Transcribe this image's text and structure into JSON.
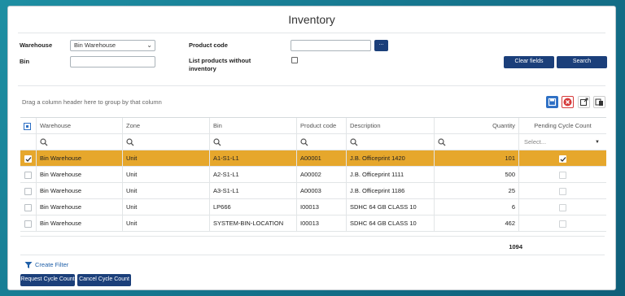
{
  "page": {
    "title": "Inventory"
  },
  "filters": {
    "warehouse_label": "Warehouse",
    "warehouse_value": "Bin Warehouse",
    "bin_label": "Bin",
    "bin_value": "",
    "product_code_label": "Product code",
    "product_code_value": "",
    "lookup_label": "...",
    "list_without_inventory_label_1": "List products without",
    "list_without_inventory_label_2": "inventory",
    "list_without_inventory_checked": false,
    "clear_label": "Clear fields",
    "search_label": "Search"
  },
  "grid": {
    "group_hint": "Drag a column header here to group by that column",
    "columns": [
      "Warehouse",
      "Zone",
      "Bin",
      "Product code",
      "Description",
      "Quantity",
      "Pending Cycle Count"
    ],
    "pending_filter_placeholder": "Select...",
    "rows": [
      {
        "warehouse": "Bin Warehouse",
        "zone": "Unit",
        "bin": "A1-S1-L1",
        "product_code": "A00001",
        "description": "J.B. Officeprint 1420",
        "quantity": "101",
        "pending": true,
        "selected": true
      },
      {
        "warehouse": "Bin Warehouse",
        "zone": "Unit",
        "bin": "A2-S1-L1",
        "product_code": "A00002",
        "description": "J.B. Officeprint 1111",
        "quantity": "500",
        "pending": false,
        "selected": false
      },
      {
        "warehouse": "Bin Warehouse",
        "zone": "Unit",
        "bin": "A3-S1-L1",
        "product_code": "A00003",
        "description": "J.B. Officeprint 1186",
        "quantity": "25",
        "pending": false,
        "selected": false
      },
      {
        "warehouse": "Bin Warehouse",
        "zone": "Unit",
        "bin": "LP666",
        "product_code": "I00013",
        "description": "SDHC 64 GB CLASS 10",
        "quantity": "6",
        "pending": false,
        "selected": false
      },
      {
        "warehouse": "Bin Warehouse",
        "zone": "Unit",
        "bin": "SYSTEM-BIN-LOCATION",
        "product_code": "I00013",
        "description": "SDHC 64 GB CLASS 10",
        "quantity": "462",
        "pending": false,
        "selected": false
      }
    ],
    "total_quantity": "1094"
  },
  "footer": {
    "create_filter_label": "Create Filter",
    "request_label": "Request Cycle Count",
    "cancel_label": "Cancel Cycle Count"
  },
  "colors": {
    "selected_row": "#e6a72c",
    "button_navy": "#1b3f7a",
    "save_icon_blue": "#2d6fc4",
    "cancel_icon_red": "#d63a3a",
    "link_blue": "#1f5fa8"
  },
  "icons": [
    "search-icon",
    "save-icon",
    "cancel-icon",
    "export-icon",
    "columns-icon",
    "filter-icon",
    "chevron-down-icon",
    "checkmark-icon"
  ]
}
